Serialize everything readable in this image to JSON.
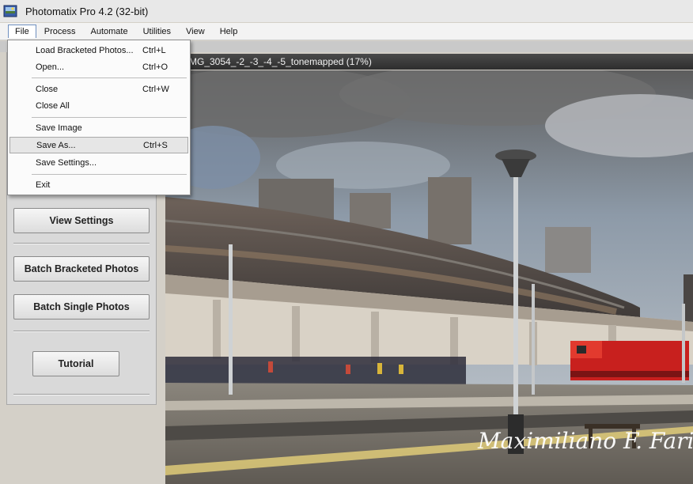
{
  "window": {
    "title": "Photomatix Pro 4.2 (32-bit)"
  },
  "menubar": {
    "items": [
      {
        "label": "File"
      },
      {
        "label": "Process"
      },
      {
        "label": "Automate"
      },
      {
        "label": "Utilities"
      },
      {
        "label": "View"
      },
      {
        "label": "Help"
      }
    ]
  },
  "file_menu": {
    "items": [
      {
        "label": "Load Bracketed Photos...",
        "shortcut": "Ctrl+L"
      },
      {
        "label": "Open...",
        "shortcut": "Ctrl+O"
      },
      {
        "label": "Close",
        "shortcut": "Ctrl+W"
      },
      {
        "label": "Close All",
        "shortcut": ""
      },
      {
        "label": "Save Image",
        "shortcut": ""
      },
      {
        "label": "Save As...",
        "shortcut": "Ctrl+S"
      },
      {
        "label": "Save Settings...",
        "shortcut": ""
      },
      {
        "label": "Exit",
        "shortcut": ""
      }
    ]
  },
  "panel": {
    "view_settings": "View Settings",
    "batch_bracketed": "Batch Bracketed Photos",
    "batch_single": "Batch Single Photos",
    "tutorial": "Tutorial"
  },
  "image_window": {
    "title": "MG_3054_-2_-3_-4_-5_tonemapped (17%)"
  },
  "photo": {
    "watermark": "Maximiliano F. Farinaro"
  },
  "colors": {
    "accent": "#6f8fbf",
    "train": "#c8201e"
  }
}
